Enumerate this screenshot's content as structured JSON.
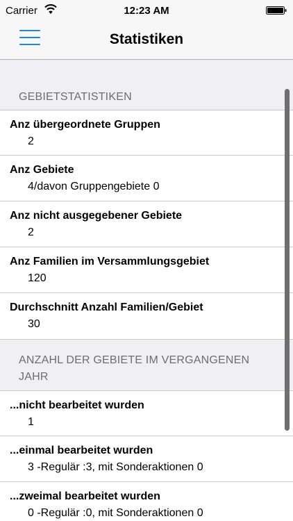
{
  "status_bar": {
    "carrier": "Carrier",
    "time": "12:23 AM"
  },
  "nav": {
    "title": "Statistiken"
  },
  "sections": [
    {
      "header": "GEBIETSTATISTIKEN",
      "rows": [
        {
          "label": "Anz übergeordnete Gruppen",
          "value": "2"
        },
        {
          "label": "Anz Gebiete",
          "value": "4/davon Gruppengebiete 0"
        },
        {
          "label": "Anz nicht ausgegebener Gebiete",
          "value": "2"
        },
        {
          "label": "Anz Familien im Versammlungsgebiet",
          "value": "120"
        },
        {
          "label": "Durchschnitt Anzahl Familien/Gebiet",
          "value": "30"
        }
      ]
    },
    {
      "header": "ANZAHL DER GEBIETE IM VERGANGENEN JAHR",
      "rows": [
        {
          "label": "...nicht bearbeitet wurden",
          "value": "1"
        },
        {
          "label": "...einmal bearbeitet wurden",
          "value": "3 -Regulär :3, mit Sonderaktionen 0"
        },
        {
          "label": "...zweimal bearbeitet wurden",
          "value": "0 -Regulär :0, mit Sonderaktionen 0"
        }
      ]
    }
  ],
  "colors": {
    "accent": "#1a82fb",
    "background": "#efeff4",
    "header_text": "#6d6d72"
  },
  "icons": [
    "wifi-icon",
    "battery-icon",
    "menu-icon"
  ]
}
